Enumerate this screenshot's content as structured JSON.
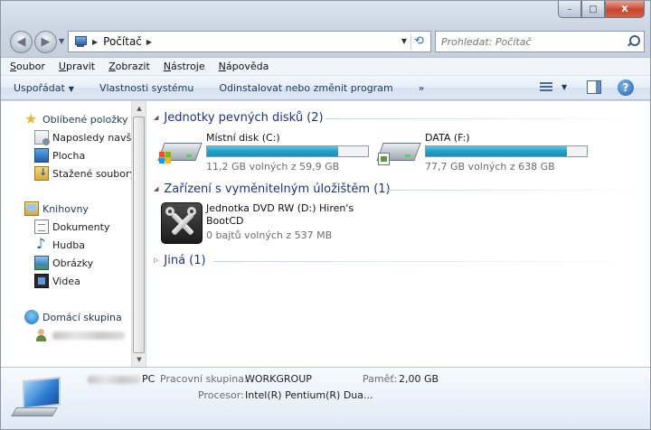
{
  "window": {
    "minimize_glyph": "–",
    "maximize_glyph": "□",
    "close_glyph": "X"
  },
  "nav": {
    "back_glyph": "◀",
    "forward_glyph": "▶",
    "history_glyph": "▼",
    "address_glyph": "▶",
    "address_crumb": "Počítač",
    "address_crumb_arrow": "▶",
    "address_dropdown_glyph": "▼",
    "refresh_glyph": "⟲",
    "search_placeholder": "Prohledat: Počítač"
  },
  "menubar": {
    "items": [
      "Soubor",
      "Upravit",
      "Zobrazit",
      "Nástroje",
      "Nápověda"
    ]
  },
  "commandbar": {
    "organize": "Uspořádat",
    "organize_arrow": "▼",
    "system_properties": "Vlastnosti systému",
    "uninstall": "Odinstalovat nebo změnit program",
    "more": "»",
    "view_arrow": "▼",
    "help": "?"
  },
  "sidebar": {
    "favorites": {
      "label": "Oblíbené položky",
      "icon": "star-icon",
      "items": [
        {
          "label": "Naposledy navšti",
          "icon": "recent-places-icon"
        },
        {
          "label": "Plocha",
          "icon": "desktop-icon"
        },
        {
          "label": "Stažené soubory",
          "icon": "downloads-icon"
        }
      ]
    },
    "libraries": {
      "label": "Knihovny",
      "icon": "libraries-icon",
      "items": [
        {
          "label": "Dokumenty",
          "icon": "documents-icon"
        },
        {
          "label": "Hudba",
          "icon": "music-icon"
        },
        {
          "label": "Obrázky",
          "icon": "pictures-icon"
        },
        {
          "label": "Videa",
          "icon": "videos-icon"
        }
      ]
    },
    "homegroup": {
      "label": "Domácí skupina",
      "icon": "homegroup-icon"
    },
    "user_icon": "user-icon",
    "scroll_up": "▲",
    "scroll_down": "▼"
  },
  "main": {
    "groups": {
      "hard_disks": {
        "title": "Jednotky pevných disků (2)",
        "glyph": "◢"
      },
      "removable": {
        "title": "Zařízení s vyměnitelným úložištěm (1)",
        "glyph": "◢"
      },
      "other": {
        "title": "Jiná (1)",
        "glyph": "▷"
      }
    },
    "drives": [
      {
        "name": "Místní disk (C:)",
        "free": "11,2 GB volných z 59,9 GB",
        "used_fraction": 0.813,
        "icon": "windows-hard-drive-icon"
      },
      {
        "name": "DATA (F:)",
        "free": "77,7 GB volných z 638 GB",
        "used_fraction": 0.878,
        "icon": "hard-drive-icon"
      }
    ],
    "dvd": {
      "name_line1": "Jednotka DVD RW (D:) Hiren's",
      "name_line2": "BootCD",
      "free": "0 bajtů volných z 537 MB",
      "icon": "tools-icon"
    }
  },
  "details": {
    "computer_suffix": "PC",
    "workgroup_label": "Pracovní skupina:",
    "workgroup_value": "WORKGROUP",
    "memory_label": "Paměť:",
    "memory_value": "2,00 GB",
    "processor_label": "Procesor:",
    "processor_value": "Intel(R) Pentium(R) Dua...",
    "icon": "computer-icon"
  },
  "colors": {
    "group_title": "#1e3287",
    "bar_fill": "#26a3cb",
    "win_flag": [
      "#f25022",
      "#7fba00",
      "#00a4ef",
      "#ffb900"
    ]
  }
}
